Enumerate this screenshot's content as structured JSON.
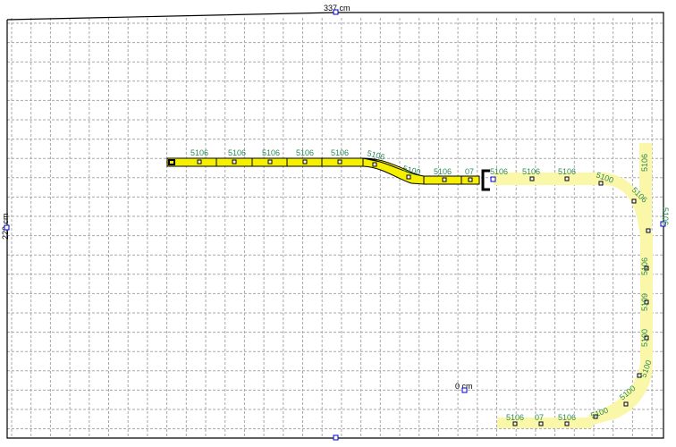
{
  "dimensions": {
    "width_label": "337 cm",
    "height_label": "220 cm",
    "origin_label": "0 cm"
  },
  "colors": {
    "grid": "#a8a8a8",
    "track_selected": "#f5f000",
    "track_unselected": "#fbf7a8",
    "label_text": "#2e8b57",
    "handle": "#0000cc"
  },
  "track_labels": {
    "top_run": [
      "5106",
      "5106",
      "5106",
      "5106",
      "5106",
      "5106",
      "5100",
      "5106",
      "07"
    ],
    "top_right": [
      "5106",
      "5106",
      "5106",
      "5100"
    ],
    "right_column": [
      "5106",
      "5106",
      "5106",
      "5109",
      "5106",
      "5100",
      "5100"
    ],
    "bottom": [
      "5106",
      "07",
      "5106",
      "5100"
    ]
  }
}
